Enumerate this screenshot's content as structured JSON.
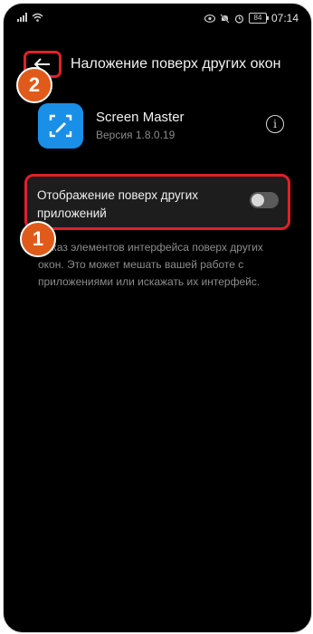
{
  "status_bar": {
    "time": "07:14",
    "battery": "84",
    "icons": [
      "signal-icon",
      "wifi-icon",
      "eye-icon",
      "mute-icon",
      "alarm-icon",
      "battery-icon"
    ]
  },
  "header": {
    "title": "Наложение поверх других окон",
    "back_icon": "arrow-left-icon"
  },
  "app": {
    "name": "Screen Master",
    "version": "Версия 1.8.0.19",
    "icon": "screen-master-app-icon",
    "info_icon": "info-icon"
  },
  "overlay_setting": {
    "label": "Отображение поверх других приложений",
    "enabled": false
  },
  "description": "Показ элементов интерфейса поверх других окон. Это может мешать вашей работе с приложениями или искажать их интерфейс.",
  "annotations": {
    "badge_1": "1",
    "badge_2": "2"
  },
  "colors": {
    "background": "#000000",
    "card": "#1d1d1d",
    "highlight": "#e0202a",
    "badge": "#e05a1a",
    "app_icon": "#1a8fe8"
  }
}
